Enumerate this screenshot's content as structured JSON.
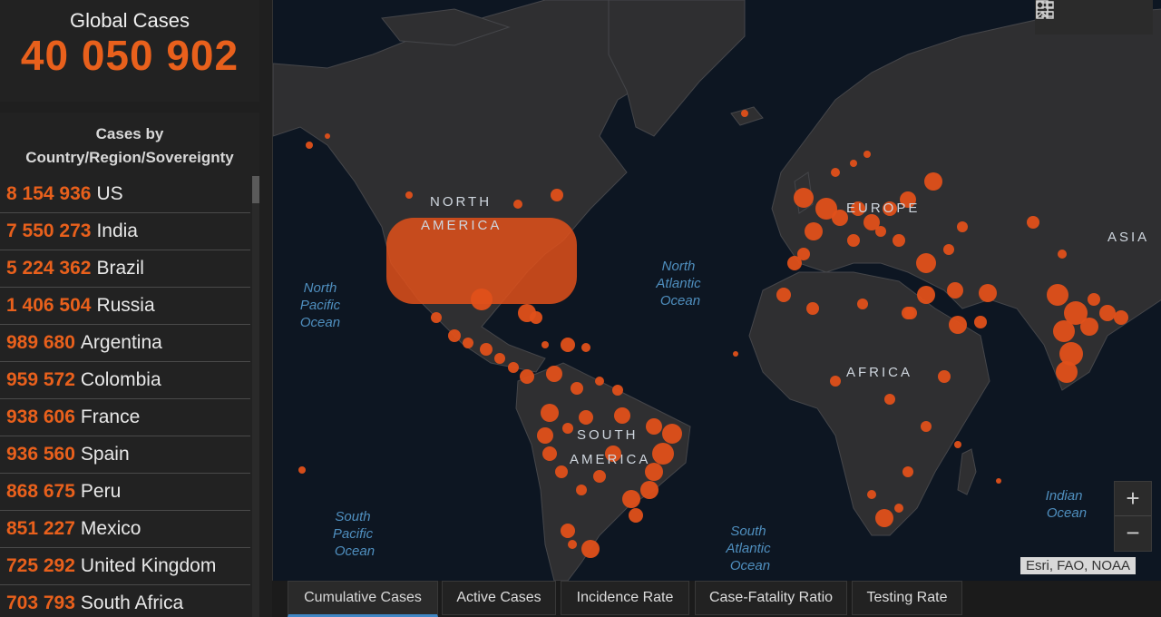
{
  "global": {
    "title": "Global Cases",
    "value": "40 050 902"
  },
  "list": {
    "header_line1": "Cases by",
    "header_line2": "Country/Region/Sovereignty",
    "rows": [
      {
        "cases": "8 154 936",
        "name": "US"
      },
      {
        "cases": "7 550 273",
        "name": "India"
      },
      {
        "cases": "5 224 362",
        "name": "Brazil"
      },
      {
        "cases": "1 406 504",
        "name": "Russia"
      },
      {
        "cases": "989 680",
        "name": "Argentina"
      },
      {
        "cases": "959 572",
        "name": "Colombia"
      },
      {
        "cases": "938 606",
        "name": "France"
      },
      {
        "cases": "936 560",
        "name": "Spain"
      },
      {
        "cases": "868 675",
        "name": "Peru"
      },
      {
        "cases": "851 227",
        "name": "Mexico"
      },
      {
        "cases": "725 292",
        "name": "United Kingdom"
      },
      {
        "cases": "703 793",
        "name": "South Africa"
      }
    ]
  },
  "map": {
    "regions": {
      "north_america_1": "NORTH",
      "north_america_2": "AMERICA",
      "europe": "EUROPE",
      "asia": "ASIA",
      "africa": "AFRICA",
      "south_america_1": "SOUTH",
      "south_america_2": "AMERICA"
    },
    "oceans": {
      "north_pacific_1": "North",
      "north_pacific_2": "Pacific",
      "north_pacific_3": "Ocean",
      "north_atlantic_1": "North",
      "north_atlantic_2": "Atlantic",
      "north_atlantic_3": "Ocean",
      "south_pacific_1": "South",
      "south_pacific_2": "Pacific",
      "south_pacific_3": "Ocean",
      "south_atlantic_1": "South",
      "south_atlantic_2": "Atlantic",
      "south_atlantic_3": "Ocean",
      "indian_1": "Indian",
      "indian_2": "Ocean"
    },
    "attribution": "Esri, FAO, NOAA",
    "zoom_in": "+",
    "zoom_out": "−",
    "colors": {
      "ocean": "#0d1622",
      "land": "#2f2f31",
      "marker": "#e0501a"
    }
  },
  "toolbar": {
    "bookmark": "bookmark-icon",
    "legend": "list-icon",
    "basemap": "grid-icon"
  },
  "tabs": [
    {
      "label": "Cumulative Cases",
      "active": true
    },
    {
      "label": "Active Cases",
      "active": false
    },
    {
      "label": "Incidence Rate",
      "active": false
    },
    {
      "label": "Case-Fatality Ratio",
      "active": false
    },
    {
      "label": "Testing Rate",
      "active": false
    }
  ]
}
